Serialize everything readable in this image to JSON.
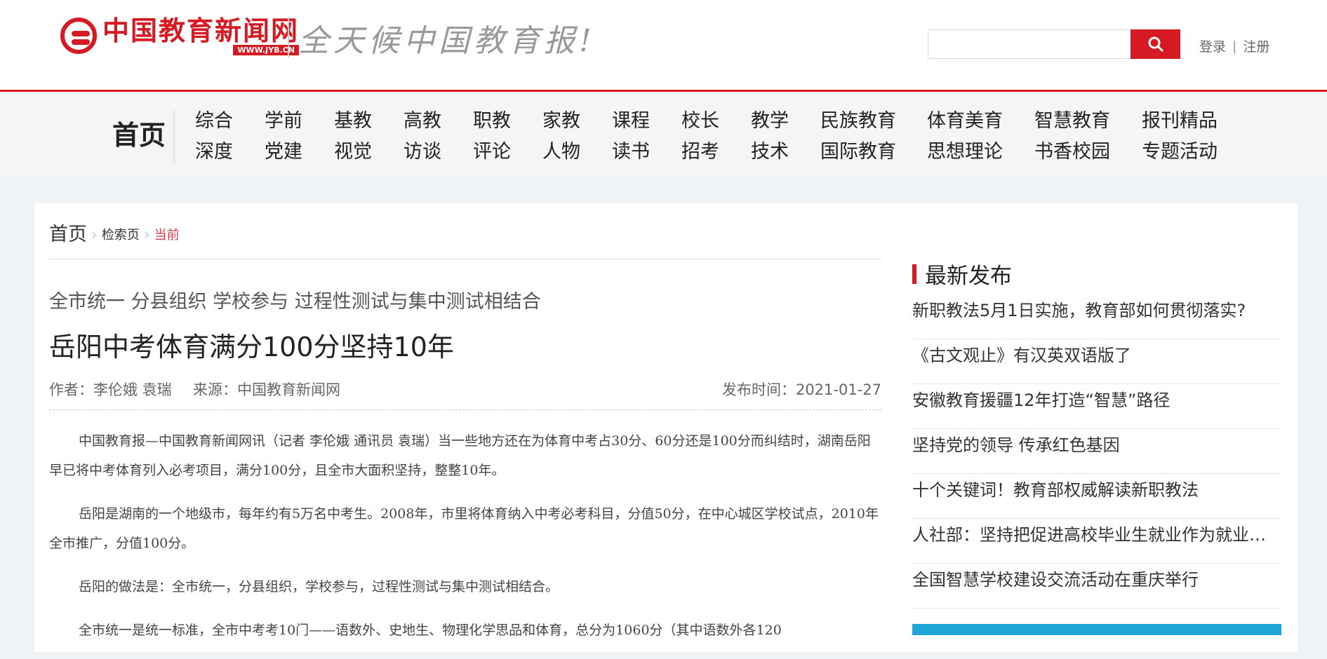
{
  "header": {
    "logo_cn": "中国教育新闻网",
    "logo_url": "WWW.JYB.CN",
    "slogan": "全天候中国教育报!",
    "search": {
      "value": "",
      "placeholder": ""
    },
    "login": "登录",
    "separator": "|",
    "register": "注册"
  },
  "nav": {
    "home": "首页",
    "row1": [
      "综合",
      "学前",
      "基教",
      "高教",
      "职教",
      "家教",
      "课程",
      "校长",
      "教学",
      "民族教育",
      "体育美育",
      "智慧教育",
      "报刊精品"
    ],
    "row2": [
      "深度",
      "党建",
      "视觉",
      "访谈",
      "评论",
      "人物",
      "读书",
      "招考",
      "技术",
      "国际教育",
      "思想理论",
      "书香校园",
      "专题活动"
    ]
  },
  "breadcrumb": {
    "home": "首页",
    "search": "检索页",
    "current": "当前"
  },
  "article": {
    "subtitle": "全市统一 分县组织 学校参与 过程性测试与集中测试相结合",
    "title": "岳阳中考体育满分100分坚持10年",
    "author": "作者：李伦娥 袁瑞",
    "source": "来源：中国教育新闻网",
    "date": "发布时间：2021-01-27",
    "paragraphs": [
      "中国教育报—中国教育新闻网讯（记者 李伦娥 通讯员 袁瑞）当一些地方还在为体育中考占30分、60分还是100分而纠结时，湖南岳阳早已将中考体育列入必考项目，满分100分，且全市大面积坚持，整整10年。",
      "岳阳是湖南的一个地级市，每年约有5万名中考生。2008年，市里将体育纳入中考必考科目，分值50分，在中心城区学校试点，2010年全市推广，分值100分。",
      "岳阳的做法是：全市统一，分县组织，学校参与，过程性测试与集中测试相结合。",
      "全市统一是统一标准，全市中考考10门——语数外、史地生、物理化学思品和体育，总分为1060分（其中语数外各120"
    ]
  },
  "sidebar": {
    "title": "最新发布",
    "items": [
      "新职教法5月1日实施，教育部如何贯彻落实?",
      "《古文观止》有汉英双语版了",
      "安徽教育援疆12年打造“智慧”路径",
      "坚持党的领导 传承红色基因",
      "十个关键词！教育部权威解读新职教法",
      "人社部：坚持把促进高校毕业生就业作为就业工作重中之重",
      "全国智慧学校建设交流活动在重庆举行"
    ]
  },
  "colors": {
    "brand": "#d61a24",
    "breadcrumb_current": "#d23a4a",
    "banner": "#1fa6d6"
  },
  "icons": {
    "search_button": "search-icon",
    "breadcrumb_separator": "chevron-right-icon"
  }
}
